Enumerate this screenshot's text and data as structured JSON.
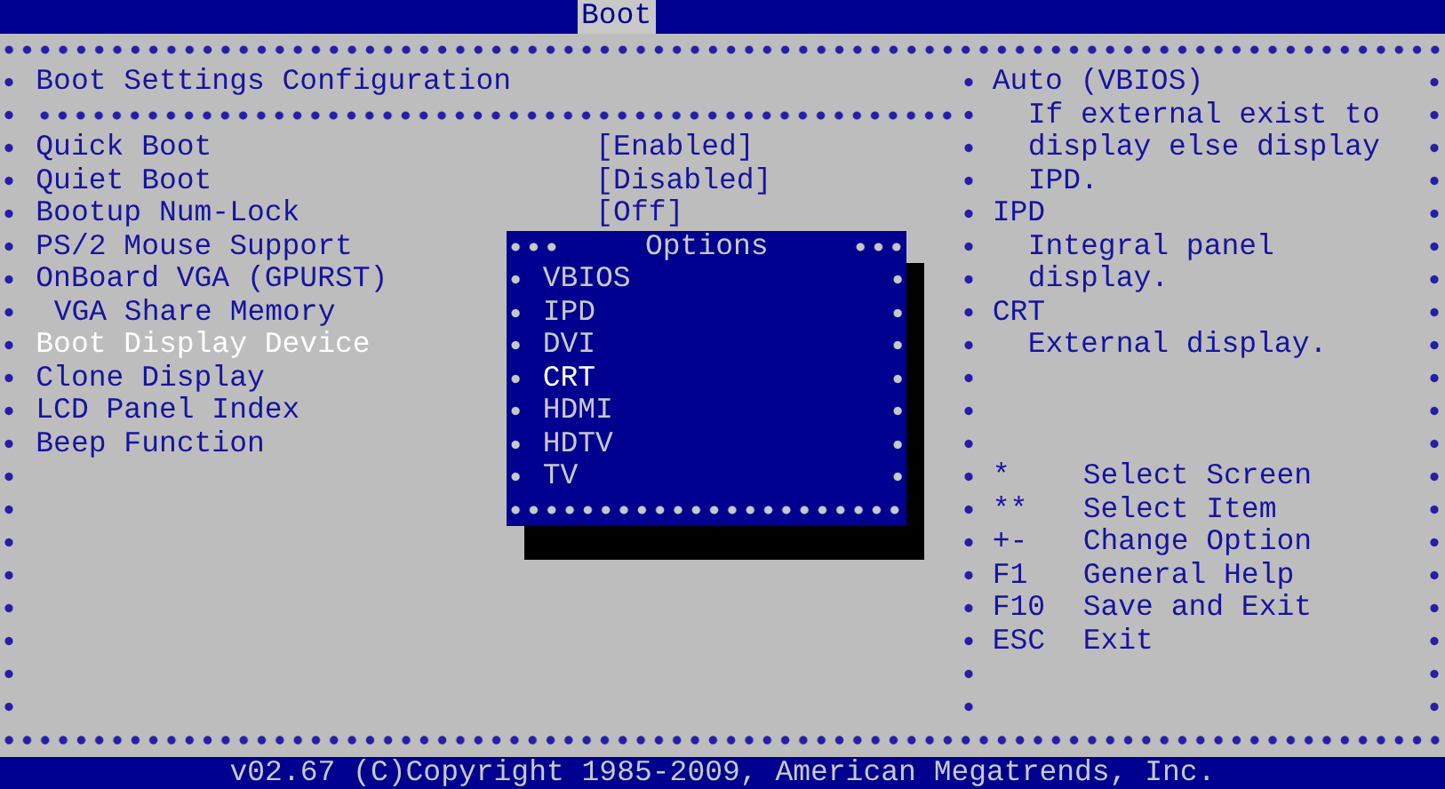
{
  "tabs": [
    {
      "label": "Boot",
      "selected": true
    }
  ],
  "section_title": "Boot Settings Configuration",
  "settings": [
    {
      "label": "Quick Boot",
      "value": "[Enabled]",
      "selected": false
    },
    {
      "label": "Quiet Boot",
      "value": "[Disabled]",
      "selected": false
    },
    {
      "label": "Bootup Num-Lock",
      "value": "[Off]",
      "selected": false
    },
    {
      "label": "PS/2 Mouse Support",
      "selected": false
    },
    {
      "label": "OnBoard VGA (GPURST)",
      "selected": false,
      "children": [
        {
          "label": "VGA Share Memory",
          "selected": false
        }
      ]
    },
    {
      "label": "Boot Display Device",
      "selected": true
    },
    {
      "label": "Clone Display",
      "selected": false
    },
    {
      "label": "LCD Panel Index",
      "selected": false
    },
    {
      "label": "Beep Function",
      "selected": false
    }
  ],
  "options_popup": {
    "title": "Options",
    "items": [
      {
        "label": "VBIOS",
        "selected": false
      },
      {
        "label": "IPD",
        "selected": false
      },
      {
        "label": "DVI",
        "selected": false
      },
      {
        "label": "CRT",
        "selected": true
      },
      {
        "label": "HDMI",
        "selected": false
      },
      {
        "label": "HDTV",
        "selected": false
      },
      {
        "label": "TV",
        "selected": false
      }
    ]
  },
  "help": [
    {
      "title": "Auto (VBIOS)",
      "lines": [
        "If external exist to",
        "display else display",
        "IPD."
      ]
    },
    {
      "title": "IPD",
      "lines": [
        "Integral panel",
        "display."
      ]
    },
    {
      "title": "CRT",
      "lines": [
        "External display."
      ]
    }
  ],
  "keys": [
    {
      "key": "*",
      "action": "Select Screen"
    },
    {
      "key": "**",
      "action": "Select Item"
    },
    {
      "key": "+-",
      "action": "Change Option"
    },
    {
      "key": "F1",
      "action": "General Help"
    },
    {
      "key": "F10",
      "action": "Save and Exit"
    },
    {
      "key": "ESC",
      "action": "Exit"
    }
  ],
  "footer": "v02.67 (C)Copyright 1985-2009, American Megatrends, Inc."
}
